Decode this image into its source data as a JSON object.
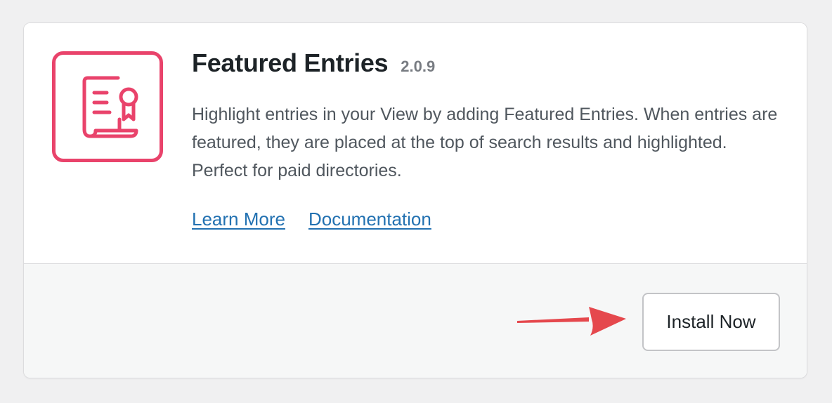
{
  "plugin": {
    "title": "Featured Entries",
    "version": "2.0.9",
    "description": "Highlight entries in your View by adding Featured Entries. When entries are featured, they are placed at the top of search results and highlighted. Perfect for paid directories.",
    "icon": "certificate-icon",
    "accent_color": "#e9436b"
  },
  "links": {
    "learn_more": "Learn More",
    "documentation": "Documentation"
  },
  "actions": {
    "install_label": "Install Now"
  },
  "annotation": {
    "arrow_icon": "red-arrow-icon",
    "arrow_color": "#e5484d"
  }
}
